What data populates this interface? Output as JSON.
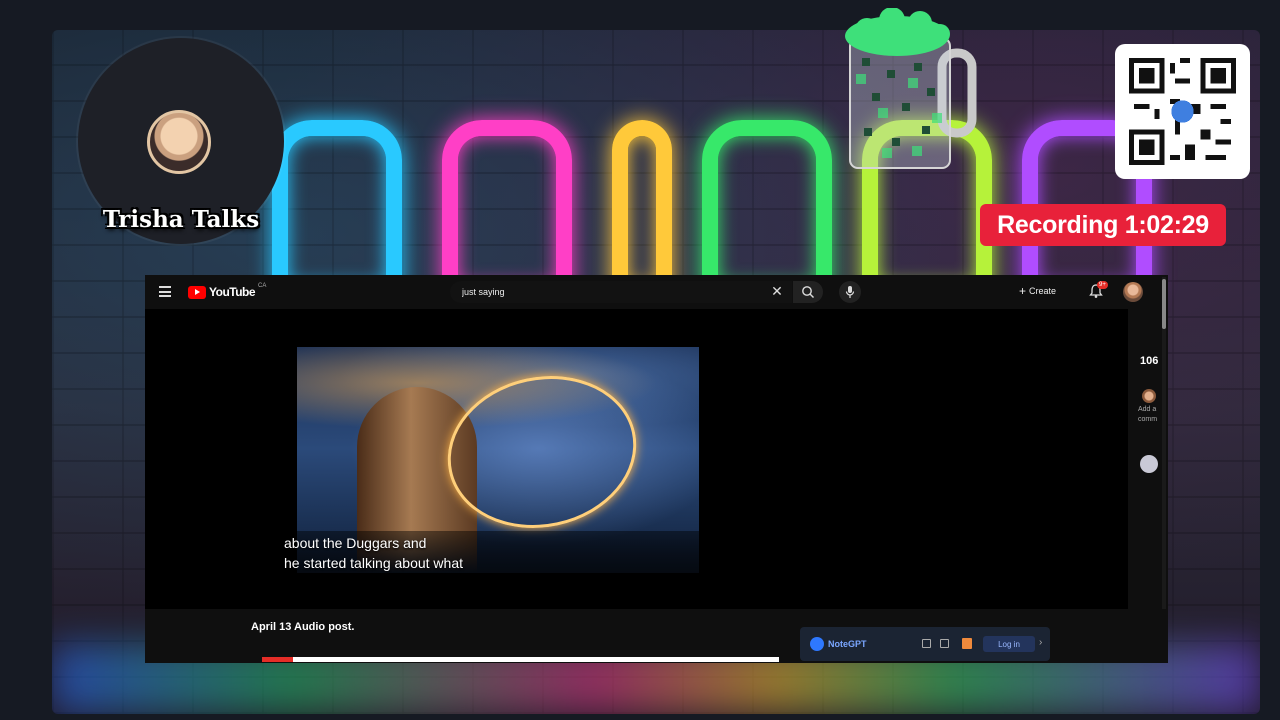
{
  "overlay": {
    "streamer_name": "Trisha Talks",
    "recording_label": "Recording 1:02:29"
  },
  "youtube": {
    "logo_text": "YouTube",
    "logo_superscript": "CA",
    "search": {
      "value": "just saying"
    },
    "create_label": "Create",
    "notification_count": "9+",
    "video": {
      "caption_line1": "about the Duggars and",
      "caption_line2": "he started talking about what",
      "progress": 0.06
    },
    "side": {
      "likes": "106",
      "add_comment": "Add a comm"
    },
    "post_title": "April 13 Audio post."
  },
  "extension": {
    "name": "NoteGPT",
    "login_label": "Log in"
  },
  "colors": {
    "recording_bg": "#e8213a",
    "youtube_red": "#ff0000",
    "extension_accent": "#2e78ff"
  },
  "icons": [
    "menu-icon",
    "search-icon",
    "microphone-icon",
    "close-icon",
    "plus-icon",
    "bell-icon",
    "qr-code-icon",
    "beer-mug-icon",
    "trash-icon",
    "chevron-right-icon"
  ]
}
